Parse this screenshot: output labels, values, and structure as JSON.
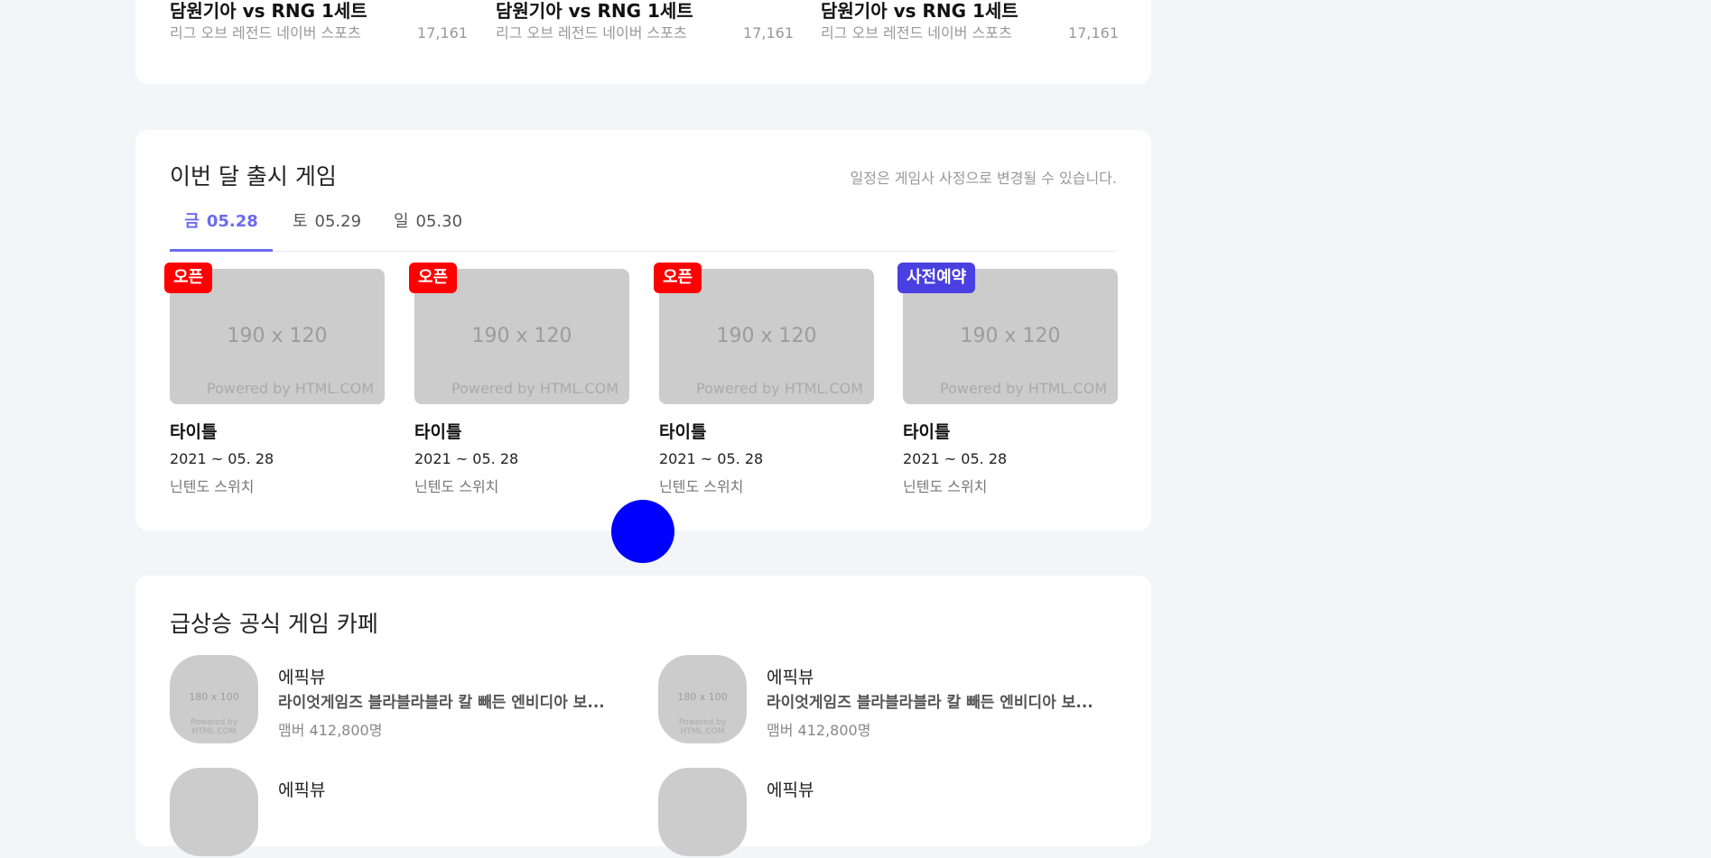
{
  "videos": [
    {
      "title": "담원기아 vs RNG 1세트",
      "channel": "리그 오브 레전드 네이버 스포츠",
      "views": "17,161"
    },
    {
      "title": "담원기아 vs RNG 1세트",
      "channel": "리그 오브 레전드 네이버 스포츠",
      "views": "17,161"
    },
    {
      "title": "담원기아 vs RNG 1세트",
      "channel": "리그 오브 레전드 네이버 스포츠",
      "views": "17,161"
    }
  ],
  "release": {
    "title": "이번 달 출시 게임",
    "note": "일정은 게임사 사정으로 변경될 수 있습니다.",
    "tabs": [
      {
        "dow": "금",
        "date": "05.28",
        "active": true
      },
      {
        "dow": "토",
        "date": "05.29",
        "active": false
      },
      {
        "dow": "일",
        "date": "05.30",
        "active": false
      }
    ],
    "games": [
      {
        "badge": "오픈",
        "badge_color": "#ff0000",
        "placeholder": "190 x 120",
        "powered": "Powered by HTML.COM",
        "title": "타이틀",
        "date": "2021 ~ 05. 28",
        "platform": "닌텐도 스위치"
      },
      {
        "badge": "오픈",
        "badge_color": "#ff0000",
        "placeholder": "190 x 120",
        "powered": "Powered by HTML.COM",
        "title": "타이틀",
        "date": "2021 ~ 05. 28",
        "platform": "닌텐도 스위치"
      },
      {
        "badge": "오픈",
        "badge_color": "#ff0000",
        "placeholder": "190 x 120",
        "powered": "Powered by HTML.COM",
        "title": "타이틀",
        "date": "2021 ~ 05. 28",
        "platform": "닌텐도 스위치"
      },
      {
        "badge": "사전예약",
        "badge_color": "#4a3fe0",
        "placeholder": "190 x 120",
        "powered": "Powered by HTML.COM",
        "title": "타이틀",
        "date": "2021 ~ 05. 28",
        "platform": "닌텐도 스위치"
      }
    ]
  },
  "cafe": {
    "title": "급상승 공식 게임 카페",
    "items": [
      {
        "placeholder": "180 x 100",
        "powered": "Powered by HTML.COM",
        "name": "에픽뷰",
        "desc": "라이엇게임즈 블라블라블라 칼 빼든 엔비디아 보...",
        "members": "맴버 412,800명"
      },
      {
        "placeholder": "180 x 100",
        "powered": "Powered by HTML.COM",
        "name": "에픽뷰",
        "desc": "라이엇게임즈 블라블라블라 칼 빼든 엔비디아 보...",
        "members": "맴버 412,800명"
      },
      {
        "placeholder": "",
        "powered": "",
        "name": "에픽뷰",
        "desc": "",
        "members": ""
      },
      {
        "placeholder": "",
        "powered": "",
        "name": "에픽뷰",
        "desc": "",
        "members": ""
      }
    ]
  },
  "colors": {
    "accent": "#6b6bf1",
    "badge_open": "#ff0000",
    "badge_reserve": "#4a3fe0",
    "cursor": "#0000ff"
  }
}
